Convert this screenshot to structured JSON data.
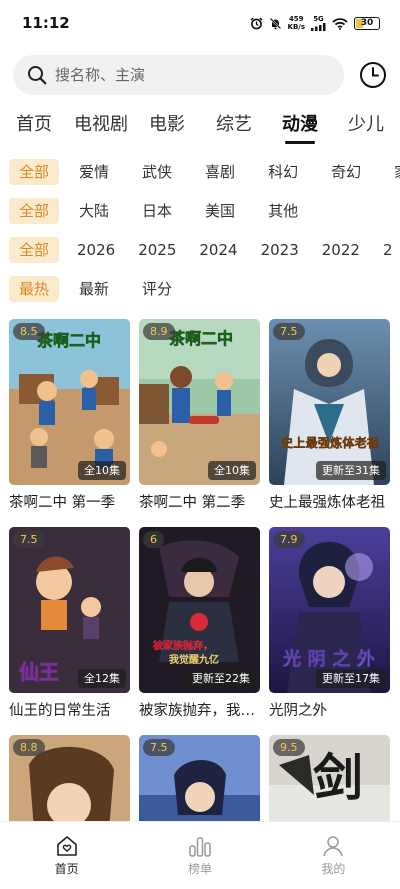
{
  "status": {
    "time": "11:12",
    "speed_value": "459",
    "speed_unit": "KB/s",
    "network": "5G",
    "battery": "30"
  },
  "search": {
    "placeholder": "搜名称、主演",
    "value": ""
  },
  "tabs": [
    {
      "label": "首页",
      "active": false
    },
    {
      "label": "电视剧",
      "active": false
    },
    {
      "label": "电影",
      "active": false
    },
    {
      "label": "综艺",
      "active": false
    },
    {
      "label": "动漫",
      "active": true
    },
    {
      "label": "少儿",
      "active": false
    }
  ],
  "filters": {
    "genre": [
      "全部",
      "爱情",
      "武侠",
      "喜剧",
      "科幻",
      "奇幻",
      "家"
    ],
    "region": [
      "全部",
      "大陆",
      "日本",
      "美国",
      "其他"
    ],
    "year": [
      "全部",
      "2026",
      "2025",
      "2024",
      "2023",
      "2022",
      "2"
    ],
    "sort": [
      "最热",
      "最新",
      "评分"
    ]
  },
  "cards": [
    {
      "title": "茶啊二中 第一季",
      "score": "8.5",
      "episodes": "全10集"
    },
    {
      "title": "茶啊二中 第二季",
      "score": "8.9",
      "episodes": "全10集"
    },
    {
      "title": "史上最强炼体老祖",
      "score": "7.5",
      "episodes": "更新至31集"
    },
    {
      "title": "仙王的日常生活",
      "score": "7.5",
      "episodes": "全12集"
    },
    {
      "title": "被家族抛弃，我觉醒九亿",
      "score": "6",
      "episodes": "更新至22集"
    },
    {
      "title": "光阴之外",
      "score": "7.9",
      "episodes": "更新至17集"
    },
    {
      "title": "",
      "score": "8.8",
      "episodes": ""
    },
    {
      "title": "",
      "score": "7.5",
      "episodes": ""
    },
    {
      "title": "",
      "score": "9.5",
      "episodes": ""
    }
  ],
  "poster_text": {
    "p1": "茶啊二中",
    "p2": "茶啊二中",
    "p3": "史上最强炼体老祖",
    "p4": "仙王",
    "p5a": "被家族抛弃，",
    "p5b": "我觉醒九亿",
    "p6": "光阴之外",
    "p9": "剑"
  },
  "bottom_nav": [
    {
      "label": "首页",
      "icon": "home-icon",
      "active": true
    },
    {
      "label": "榜单",
      "icon": "chart-icon",
      "active": false
    },
    {
      "label": "我的",
      "icon": "person-icon",
      "active": false
    }
  ],
  "colors": {
    "accent": "#d9892a",
    "chip_bg": "#fbeacc",
    "score": "#f2c94c"
  }
}
